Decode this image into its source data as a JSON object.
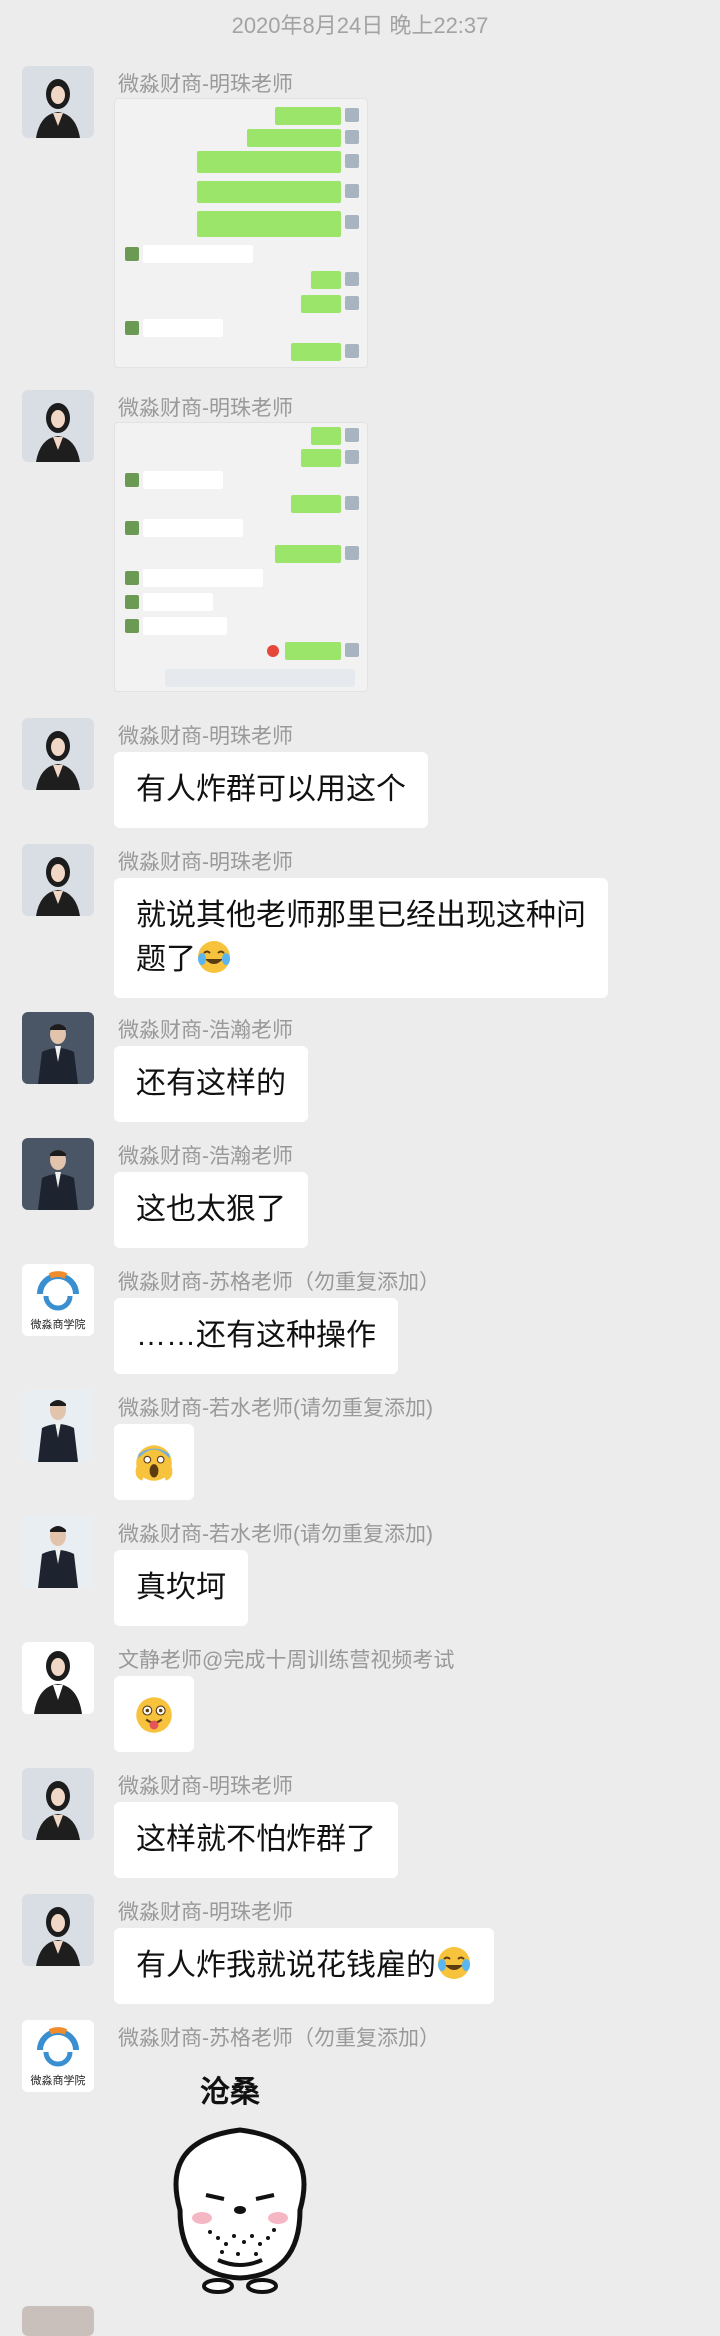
{
  "timestamp": "2020年8月24日 晚上22:37",
  "messages": [
    {
      "sender": "微淼财商-明珠老师",
      "type": "image"
    },
    {
      "sender": "微淼财商-明珠老师",
      "type": "image"
    },
    {
      "sender": "微淼财商-明珠老师",
      "text": "有人炸群可以用这个"
    },
    {
      "sender": "微淼财商-明珠老师",
      "text": "就说其他老师那里已经出现这种问题了"
    },
    {
      "sender": "微淼财商-浩瀚老师",
      "text": "还有这样的"
    },
    {
      "sender": "微淼财商-浩瀚老师",
      "text": "这也太狠了"
    },
    {
      "sender": "微淼财商-苏格老师（勿重复添加）",
      "text": "……还有这种操作",
      "avatar_caption": "微淼商学院"
    },
    {
      "sender": "微淼财商-若水老师(请勿重复添加)",
      "emoji": "scream"
    },
    {
      "sender": "微淼财商-若水老师(请勿重复添加)",
      "text": "真坎坷"
    },
    {
      "sender": "文静老师@完成十周训练营视频考试",
      "emoji": "tongue"
    },
    {
      "sender": "微淼财商-明珠老师",
      "text": "这样就不怕炸群了"
    },
    {
      "sender": "微淼财商-明珠老师",
      "text": "有人炸我就说花钱雇的"
    },
    {
      "sender": "微淼财商-苏格老师（勿重复添加）",
      "type": "sticker",
      "sticker_text": "沧桑",
      "avatar_caption": "微淼商学院"
    }
  ],
  "colors": {
    "background": "#ececec",
    "bubble": "#ffffff",
    "sent_bubble": "#9be56a",
    "name": "#999999",
    "logo_blue": "#3a8fd0",
    "logo_orange": "#f08c2c"
  },
  "icons": [
    "avatar-female-teacher",
    "avatar-male-teacher",
    "school-logo-icon",
    "scream-emoji-icon",
    "tongue-emoji-icon",
    "laugh-cry-emoji-icon",
    "sticker-blob"
  ]
}
